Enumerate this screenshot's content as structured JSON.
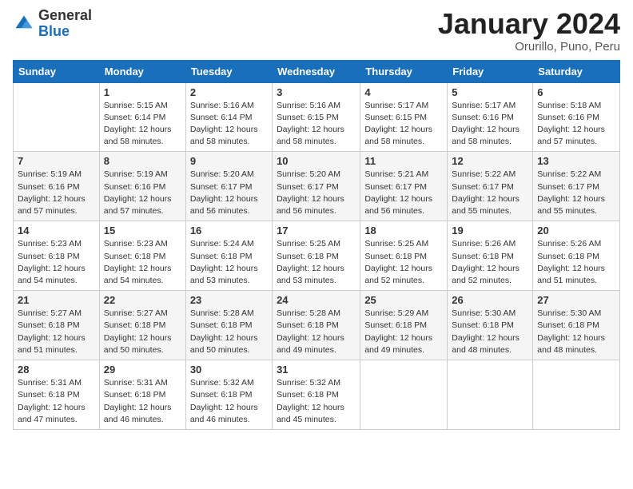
{
  "header": {
    "logo_general": "General",
    "logo_blue": "Blue",
    "title": "January 2024",
    "location": "Orurillo, Puno, Peru"
  },
  "days_of_week": [
    "Sunday",
    "Monday",
    "Tuesday",
    "Wednesday",
    "Thursday",
    "Friday",
    "Saturday"
  ],
  "weeks": [
    [
      {
        "num": "",
        "sunrise": "",
        "sunset": "",
        "daylight": ""
      },
      {
        "num": "1",
        "sunrise": "Sunrise: 5:15 AM",
        "sunset": "Sunset: 6:14 PM",
        "daylight": "Daylight: 12 hours and 58 minutes."
      },
      {
        "num": "2",
        "sunrise": "Sunrise: 5:16 AM",
        "sunset": "Sunset: 6:14 PM",
        "daylight": "Daylight: 12 hours and 58 minutes."
      },
      {
        "num": "3",
        "sunrise": "Sunrise: 5:16 AM",
        "sunset": "Sunset: 6:15 PM",
        "daylight": "Daylight: 12 hours and 58 minutes."
      },
      {
        "num": "4",
        "sunrise": "Sunrise: 5:17 AM",
        "sunset": "Sunset: 6:15 PM",
        "daylight": "Daylight: 12 hours and 58 minutes."
      },
      {
        "num": "5",
        "sunrise": "Sunrise: 5:17 AM",
        "sunset": "Sunset: 6:16 PM",
        "daylight": "Daylight: 12 hours and 58 minutes."
      },
      {
        "num": "6",
        "sunrise": "Sunrise: 5:18 AM",
        "sunset": "Sunset: 6:16 PM",
        "daylight": "Daylight: 12 hours and 57 minutes."
      }
    ],
    [
      {
        "num": "7",
        "sunrise": "Sunrise: 5:19 AM",
        "sunset": "Sunset: 6:16 PM",
        "daylight": "Daylight: 12 hours and 57 minutes."
      },
      {
        "num": "8",
        "sunrise": "Sunrise: 5:19 AM",
        "sunset": "Sunset: 6:16 PM",
        "daylight": "Daylight: 12 hours and 57 minutes."
      },
      {
        "num": "9",
        "sunrise": "Sunrise: 5:20 AM",
        "sunset": "Sunset: 6:17 PM",
        "daylight": "Daylight: 12 hours and 56 minutes."
      },
      {
        "num": "10",
        "sunrise": "Sunrise: 5:20 AM",
        "sunset": "Sunset: 6:17 PM",
        "daylight": "Daylight: 12 hours and 56 minutes."
      },
      {
        "num": "11",
        "sunrise": "Sunrise: 5:21 AM",
        "sunset": "Sunset: 6:17 PM",
        "daylight": "Daylight: 12 hours and 56 minutes."
      },
      {
        "num": "12",
        "sunrise": "Sunrise: 5:22 AM",
        "sunset": "Sunset: 6:17 PM",
        "daylight": "Daylight: 12 hours and 55 minutes."
      },
      {
        "num": "13",
        "sunrise": "Sunrise: 5:22 AM",
        "sunset": "Sunset: 6:17 PM",
        "daylight": "Daylight: 12 hours and 55 minutes."
      }
    ],
    [
      {
        "num": "14",
        "sunrise": "Sunrise: 5:23 AM",
        "sunset": "Sunset: 6:18 PM",
        "daylight": "Daylight: 12 hours and 54 minutes."
      },
      {
        "num": "15",
        "sunrise": "Sunrise: 5:23 AM",
        "sunset": "Sunset: 6:18 PM",
        "daylight": "Daylight: 12 hours and 54 minutes."
      },
      {
        "num": "16",
        "sunrise": "Sunrise: 5:24 AM",
        "sunset": "Sunset: 6:18 PM",
        "daylight": "Daylight: 12 hours and 53 minutes."
      },
      {
        "num": "17",
        "sunrise": "Sunrise: 5:25 AM",
        "sunset": "Sunset: 6:18 PM",
        "daylight": "Daylight: 12 hours and 53 minutes."
      },
      {
        "num": "18",
        "sunrise": "Sunrise: 5:25 AM",
        "sunset": "Sunset: 6:18 PM",
        "daylight": "Daylight: 12 hours and 52 minutes."
      },
      {
        "num": "19",
        "sunrise": "Sunrise: 5:26 AM",
        "sunset": "Sunset: 6:18 PM",
        "daylight": "Daylight: 12 hours and 52 minutes."
      },
      {
        "num": "20",
        "sunrise": "Sunrise: 5:26 AM",
        "sunset": "Sunset: 6:18 PM",
        "daylight": "Daylight: 12 hours and 51 minutes."
      }
    ],
    [
      {
        "num": "21",
        "sunrise": "Sunrise: 5:27 AM",
        "sunset": "Sunset: 6:18 PM",
        "daylight": "Daylight: 12 hours and 51 minutes."
      },
      {
        "num": "22",
        "sunrise": "Sunrise: 5:27 AM",
        "sunset": "Sunset: 6:18 PM",
        "daylight": "Daylight: 12 hours and 50 minutes."
      },
      {
        "num": "23",
        "sunrise": "Sunrise: 5:28 AM",
        "sunset": "Sunset: 6:18 PM",
        "daylight": "Daylight: 12 hours and 50 minutes."
      },
      {
        "num": "24",
        "sunrise": "Sunrise: 5:28 AM",
        "sunset": "Sunset: 6:18 PM",
        "daylight": "Daylight: 12 hours and 49 minutes."
      },
      {
        "num": "25",
        "sunrise": "Sunrise: 5:29 AM",
        "sunset": "Sunset: 6:18 PM",
        "daylight": "Daylight: 12 hours and 49 minutes."
      },
      {
        "num": "26",
        "sunrise": "Sunrise: 5:30 AM",
        "sunset": "Sunset: 6:18 PM",
        "daylight": "Daylight: 12 hours and 48 minutes."
      },
      {
        "num": "27",
        "sunrise": "Sunrise: 5:30 AM",
        "sunset": "Sunset: 6:18 PM",
        "daylight": "Daylight: 12 hours and 48 minutes."
      }
    ],
    [
      {
        "num": "28",
        "sunrise": "Sunrise: 5:31 AM",
        "sunset": "Sunset: 6:18 PM",
        "daylight": "Daylight: 12 hours and 47 minutes."
      },
      {
        "num": "29",
        "sunrise": "Sunrise: 5:31 AM",
        "sunset": "Sunset: 6:18 PM",
        "daylight": "Daylight: 12 hours and 46 minutes."
      },
      {
        "num": "30",
        "sunrise": "Sunrise: 5:32 AM",
        "sunset": "Sunset: 6:18 PM",
        "daylight": "Daylight: 12 hours and 46 minutes."
      },
      {
        "num": "31",
        "sunrise": "Sunrise: 5:32 AM",
        "sunset": "Sunset: 6:18 PM",
        "daylight": "Daylight: 12 hours and 45 minutes."
      },
      {
        "num": "",
        "sunrise": "",
        "sunset": "",
        "daylight": ""
      },
      {
        "num": "",
        "sunrise": "",
        "sunset": "",
        "daylight": ""
      },
      {
        "num": "",
        "sunrise": "",
        "sunset": "",
        "daylight": ""
      }
    ]
  ]
}
